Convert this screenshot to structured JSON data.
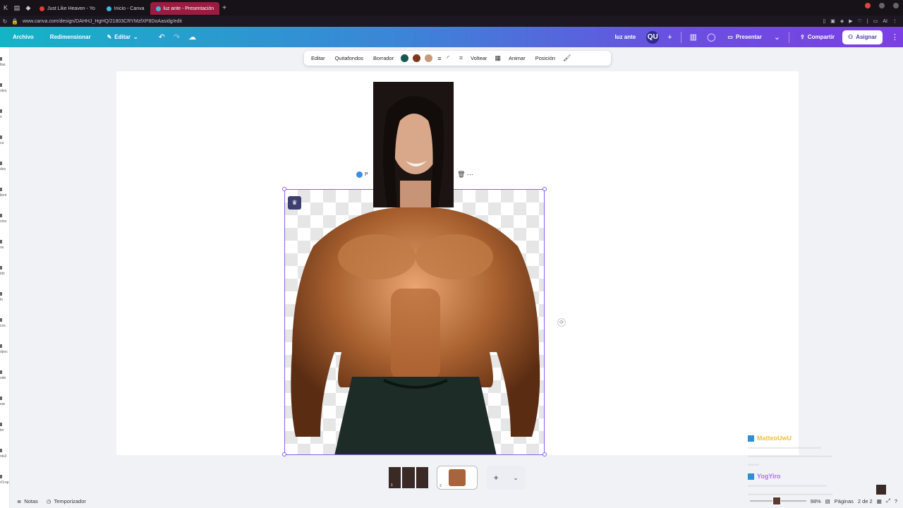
{
  "browser": {
    "tabs": [
      {
        "label": "Just Like Heaven - Yo",
        "color": "#e43b3b",
        "active": false
      },
      {
        "label": "Inicio - Canva",
        "color": "#3db9e0",
        "active": false
      },
      {
        "label": "luz ante - Presentación",
        "color": "#3db9e0",
        "active": true
      }
    ],
    "new_tab": "+",
    "url": "www.canva.com/design/DAHHJ_HgHQ/21803CRYMzfXP8DoAasidg/edit",
    "ext_label": "AI"
  },
  "header": {
    "archivo": "Archivo",
    "redimensionar": "Redimensionar",
    "editar": "Editar",
    "design_title": "luz ante",
    "avatar": "QU",
    "presentar": "Presentar",
    "compartir": "Compartir",
    "asignar": "Asignar"
  },
  "rail": {
    "items": [
      "llas",
      "ntes",
      "o",
      "ca",
      "dos",
      "lient",
      "ctos",
      "os",
      "ido",
      "lo",
      "cos",
      "dpoc",
      "ode",
      "ear",
      "ler",
      "nts3",
      "rCrop"
    ]
  },
  "toolbar": {
    "editar": "Editar",
    "quitafondos": "Quitafondos",
    "borrador": "Borrador",
    "colors": [
      "#175750",
      "#7a3a1e",
      "#c89b78"
    ],
    "voltear": "Voltear",
    "animar": "Animar",
    "posicion": "Posición"
  },
  "canvas": {
    "floatbar_label": "P",
    "crown_icon": "crown-icon"
  },
  "pages": {
    "thumb1_num": "1",
    "thumb2_num": "2",
    "add": "+"
  },
  "footer": {
    "notas": "Notas",
    "temporizador": "Temporizador",
    "zoom": "98%",
    "paginas": "Páginas",
    "page_count": "2 de 2"
  },
  "chat": [
    {
      "name": "MatteoUwU",
      "color": "#f0c040"
    },
    {
      "name": "YogYiro",
      "color": "#b070ff"
    }
  ]
}
